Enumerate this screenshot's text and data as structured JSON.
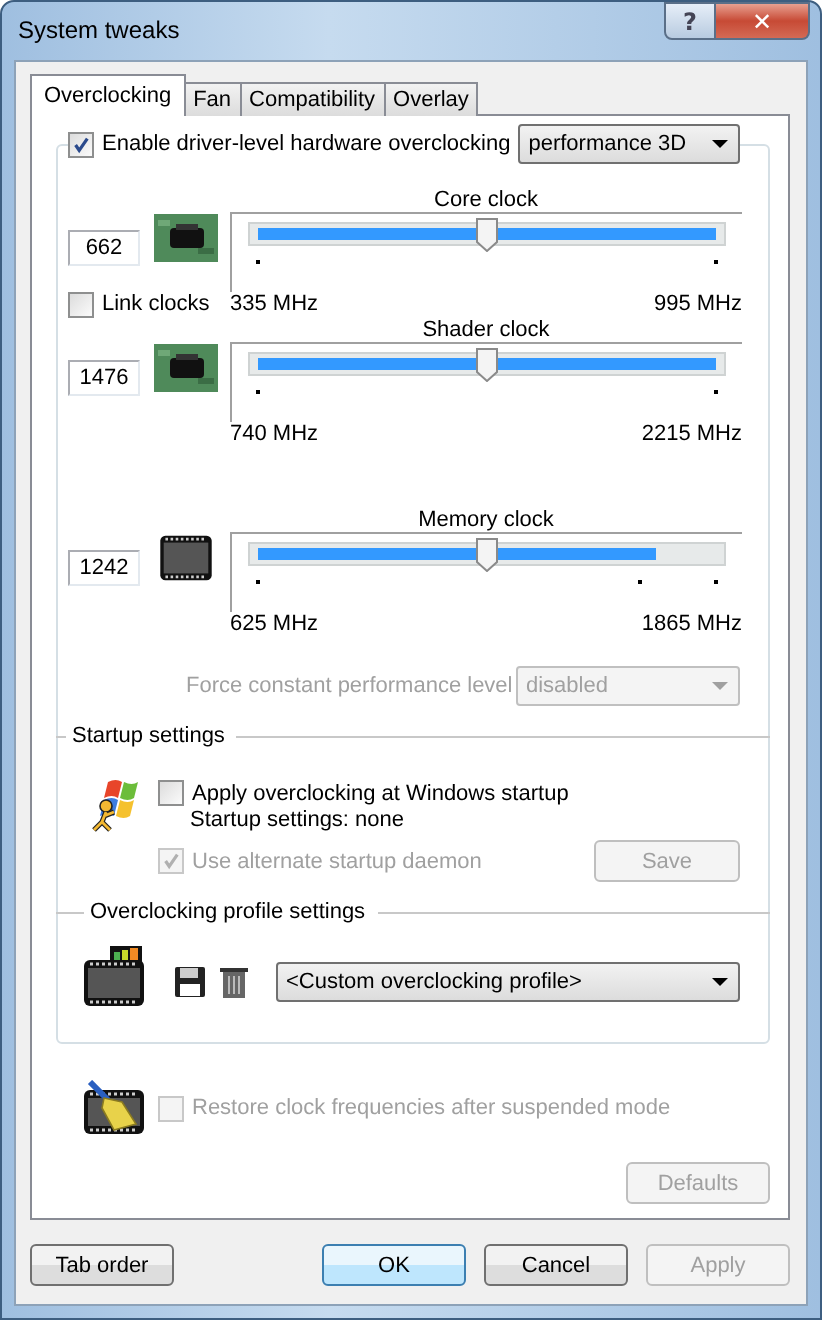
{
  "window": {
    "title": "System tweaks",
    "help": "?",
    "close": "✕"
  },
  "tabs": [
    {
      "label": "Overclocking",
      "selected": true
    },
    {
      "label": "Fan",
      "selected": false
    },
    {
      "label": "Compatibility",
      "selected": false
    },
    {
      "label": "Overlay",
      "selected": false
    }
  ],
  "overclocking": {
    "enable": {
      "label": "Enable driver-level hardware overclocking",
      "checked": true
    },
    "mode": {
      "value": "performance 3D"
    },
    "link_clocks": {
      "label": "Link clocks",
      "checked": false
    },
    "clocks": [
      {
        "title": "Core clock",
        "value": "662",
        "kind": "board",
        "level": 0.5,
        "range": {
          "level": 1
        },
        "min": "335 MHz",
        "max": "995 MHz"
      },
      {
        "title": "Shader clock",
        "value": "1476",
        "kind": "board",
        "level": 0.5,
        "range": {
          "level": 1
        },
        "min": "740 MHz",
        "max": "2215 MHz"
      },
      {
        "title": "Memory clock",
        "value": "1242",
        "kind": "memory",
        "level": 0.5,
        "range": {
          "level": 0.84
        },
        "min": "625 MHz",
        "max": "1865 MHz"
      }
    ],
    "force_level": {
      "label": "Force constant performance level",
      "value": "disabled",
      "disabled": true
    }
  },
  "startup": {
    "title": "Startup settings",
    "apply": {
      "label": "Apply overclocking at Windows startup",
      "checked": false
    },
    "note": "Startup settings: none",
    "daemon": {
      "label": "Use alternate startup daemon",
      "checked": true,
      "disabled": true
    },
    "save": {
      "label": "Save",
      "disabled": true
    }
  },
  "profiles": {
    "title": "Overclocking profile settings",
    "value": "<Custom overclocking profile>"
  },
  "restore": {
    "label": "Restore clock frequencies after suspended mode",
    "checked": false,
    "disabled": true
  },
  "defaults": {
    "label": "Defaults",
    "disabled": true
  },
  "buttons": [
    {
      "label": "Tab order",
      "default": false,
      "disabled": false
    },
    {
      "label": "OK",
      "default": true,
      "disabled": false
    },
    {
      "label": "Cancel",
      "default": false,
      "disabled": false
    },
    {
      "label": "Apply",
      "default": false,
      "disabled": true
    }
  ]
}
